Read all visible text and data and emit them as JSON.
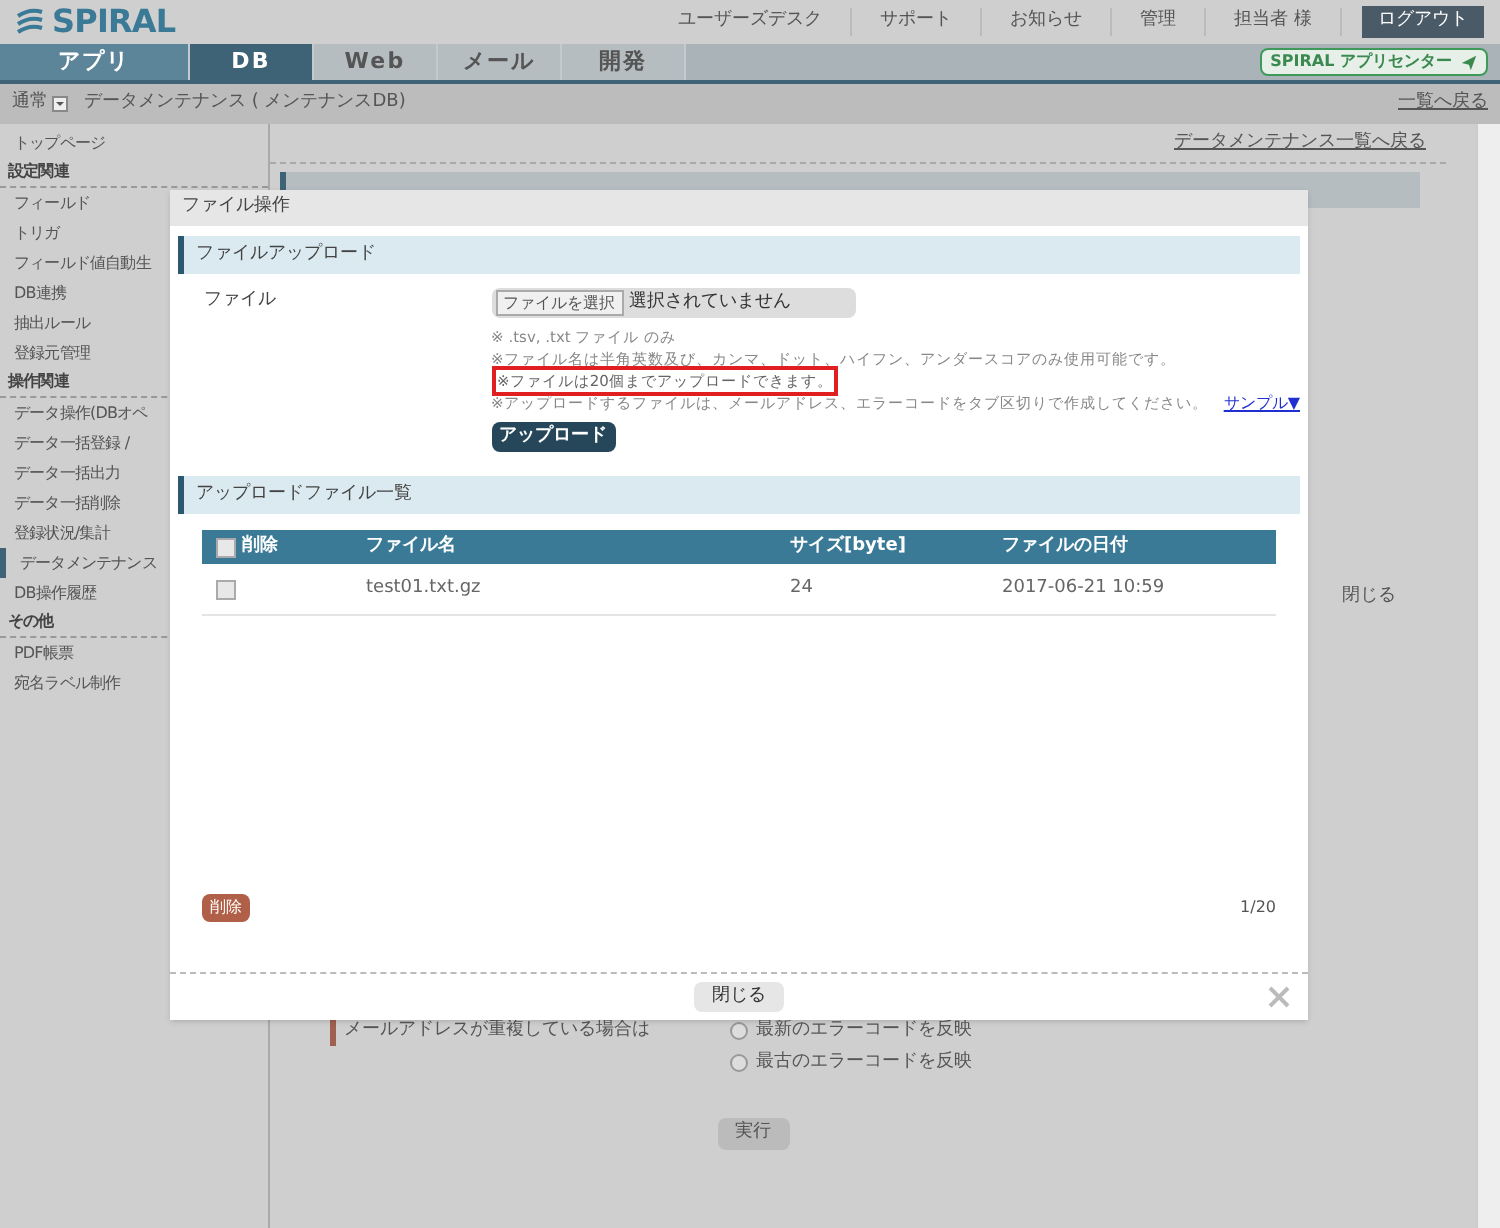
{
  "header": {
    "logo": "SPIRAL",
    "links": [
      "ユーザーズデスク",
      "サポート",
      "お知らせ",
      "管理",
      "担当者 様"
    ],
    "logout": "ログアウト"
  },
  "tabs": [
    {
      "label": "アプリ",
      "selected": false
    },
    {
      "label": "DB",
      "selected": true
    },
    {
      "label": "Web",
      "selected": false
    },
    {
      "label": "メール",
      "selected": false
    },
    {
      "label": "開発",
      "selected": false
    }
  ],
  "app_center": "SPIRAL アプリセンター",
  "breadcrumb": {
    "mode": "通常",
    "title": "データメンテナンス ( メンテナンスDB)",
    "back": "一覧へ戻る"
  },
  "sidebar": [
    {
      "kind": "item",
      "label": "トップページ",
      "selected": false
    },
    {
      "kind": "heading",
      "label": "設定関連",
      "selected": false
    },
    {
      "kind": "item",
      "label": "フィールド",
      "selected": false
    },
    {
      "kind": "item",
      "label": "トリガ",
      "selected": false
    },
    {
      "kind": "item",
      "label": "フィールド値自動生",
      "selected": false
    },
    {
      "kind": "item",
      "label": "DB連携",
      "selected": false
    },
    {
      "kind": "item",
      "label": "抽出ルール",
      "selected": false
    },
    {
      "kind": "item",
      "label": "登録元管理",
      "selected": false
    },
    {
      "kind": "heading",
      "label": "操作関連",
      "selected": false
    },
    {
      "kind": "item",
      "label": "データ操作(DBオペ",
      "selected": false
    },
    {
      "kind": "item",
      "label": "データ一括登録 /",
      "selected": false
    },
    {
      "kind": "item",
      "label": "データ一括出力",
      "selected": false
    },
    {
      "kind": "item",
      "label": "データ一括削除",
      "selected": false
    },
    {
      "kind": "item",
      "label": "登録状況/集計",
      "selected": false
    },
    {
      "kind": "item",
      "label": "データメンテナンス",
      "selected": true
    },
    {
      "kind": "item",
      "label": "DB操作履歴",
      "selected": false
    },
    {
      "kind": "heading",
      "label": "その他",
      "selected": false
    },
    {
      "kind": "item",
      "label": "PDF帳票",
      "selected": false
    },
    {
      "kind": "item",
      "label": "宛名ラベル制作",
      "selected": false
    }
  ],
  "main": {
    "back_link": "データメンテナンス一覧へ戻る",
    "close_link": "閉じる",
    "duplicate_label": "メールアドレスが重複している場合は",
    "options": [
      {
        "label": "最新のエラーコードを反映",
        "selected": false
      },
      {
        "label": "最古のエラーコードを反映",
        "selected": false
      }
    ],
    "run_button": "実行"
  },
  "modal": {
    "title": "ファイル操作",
    "upload": {
      "title": "ファイルアップロード",
      "field_label": "ファイル",
      "choose_button": "ファイルを選択",
      "no_file": "選択されていません",
      "notes": [
        {
          "text": "※ .tsv, .txt ファイル のみ",
          "highlighted": false
        },
        {
          "text": "※ファイル名は半角英数及び、カンマ、ドット、ハイフン、アンダースコアのみ使用可能です。",
          "highlighted": false
        },
        {
          "text": "※ファイルは20個までアップロードできます。",
          "highlighted": true
        },
        {
          "text": "※アップロードするファイルは、メールアドレス、エラーコードをタブ区切りで作成してください。",
          "highlighted": false
        }
      ],
      "sample_link": "サンプル▼",
      "upload_button": "アップロード"
    },
    "list": {
      "title": "アップロードファイル一覧",
      "all_checked": false,
      "columns": [
        "削除",
        "ファイル名",
        "サイズ[byte]",
        "ファイルの日付"
      ],
      "rows": [
        {
          "checked": false,
          "cells": [
            "",
            "test01.txt.gz",
            "24",
            "2017-06-21 10:59"
          ]
        }
      ],
      "delete_button": "削除",
      "page_count": "1/20"
    },
    "close_button": "閉じる"
  }
}
